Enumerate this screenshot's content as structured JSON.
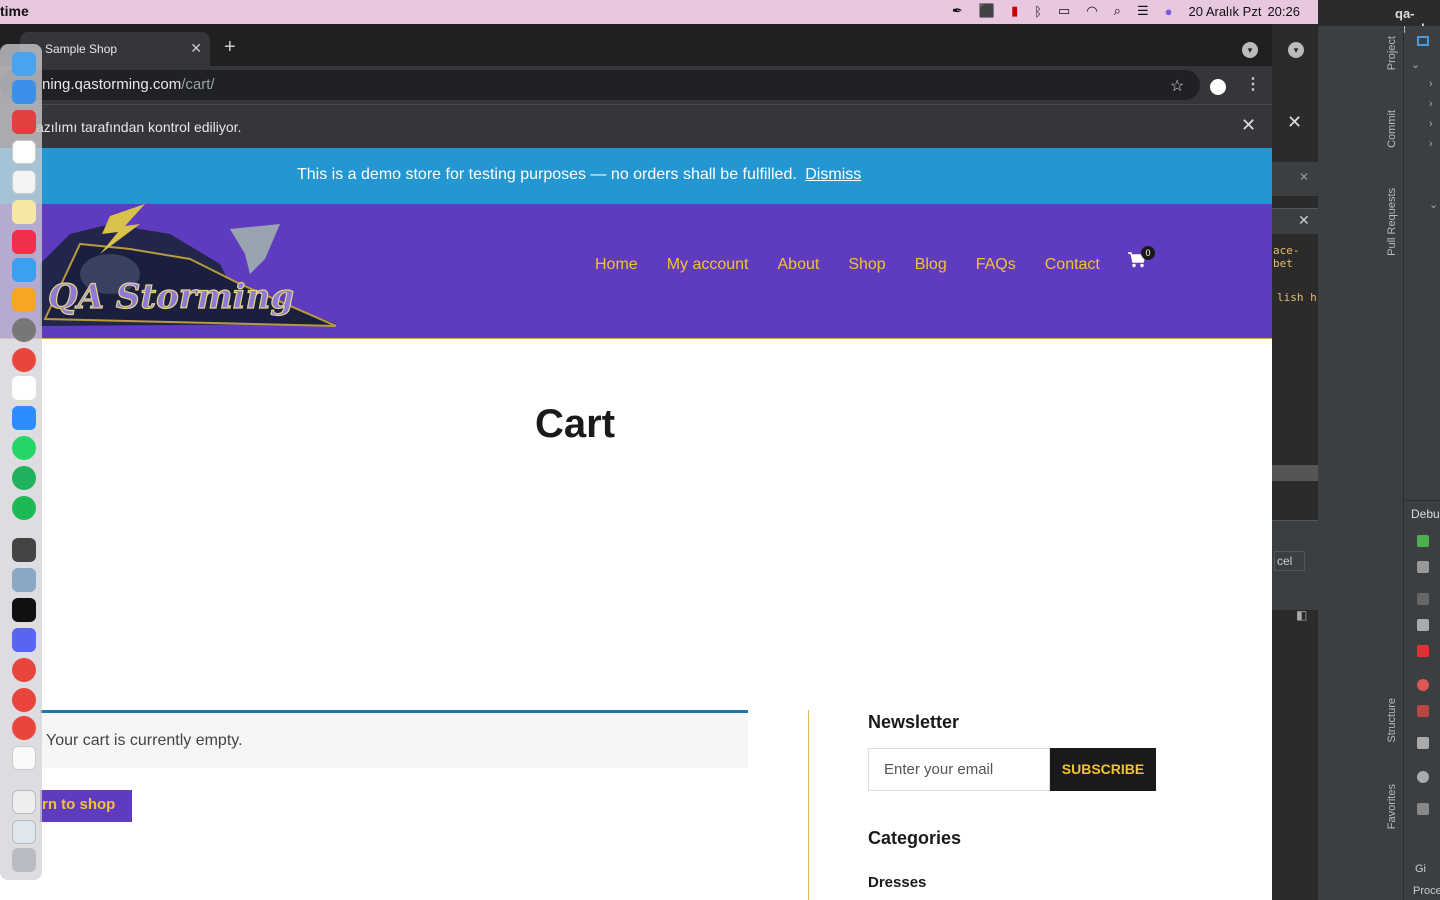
{
  "menubar": {
    "app_name": "time",
    "date": "20 Aralık Pzt",
    "time": "20:26"
  },
  "browser": {
    "tab_title": "Sample Shop",
    "url_host": "ning.qastorming.com",
    "url_path": "/cart/",
    "infobar_message": "azılımı tarafından kontrol ediliyor."
  },
  "site": {
    "demo_notice": "This is a demo store for testing purposes — no orders shall be fulfilled.",
    "dismiss": "Dismiss",
    "logo_text": "QA Storming",
    "nav": [
      "Home",
      "My account",
      "About",
      "Shop",
      "Blog",
      "FAQs",
      "Contact"
    ],
    "cart_count": "0",
    "page_title": "Cart",
    "empty_message": "Your cart is currently empty.",
    "return_button": "rn to shop",
    "newsletter_heading": "Newsletter",
    "email_placeholder": "Enter your email",
    "subscribe_label": "SUBSCRIBE",
    "categories_heading": "Categories",
    "category_first": "Dresses"
  },
  "ide": {
    "project_title": "qa-acad",
    "tabs": [
      "Project",
      "Commit",
      "Pull Requests",
      "Structure",
      "Favorites"
    ],
    "debug_label": "Debu",
    "bottom_labels": [
      "Gi",
      "Proce"
    ],
    "code_snippets": [
      "ace-bet",
      "lish h"
    ],
    "panel_text": [
      "cel"
    ]
  },
  "colors": {
    "header_purple": "#5f3bbf",
    "nav_gold": "#f3c233",
    "notice_blue": "#2496d2"
  }
}
